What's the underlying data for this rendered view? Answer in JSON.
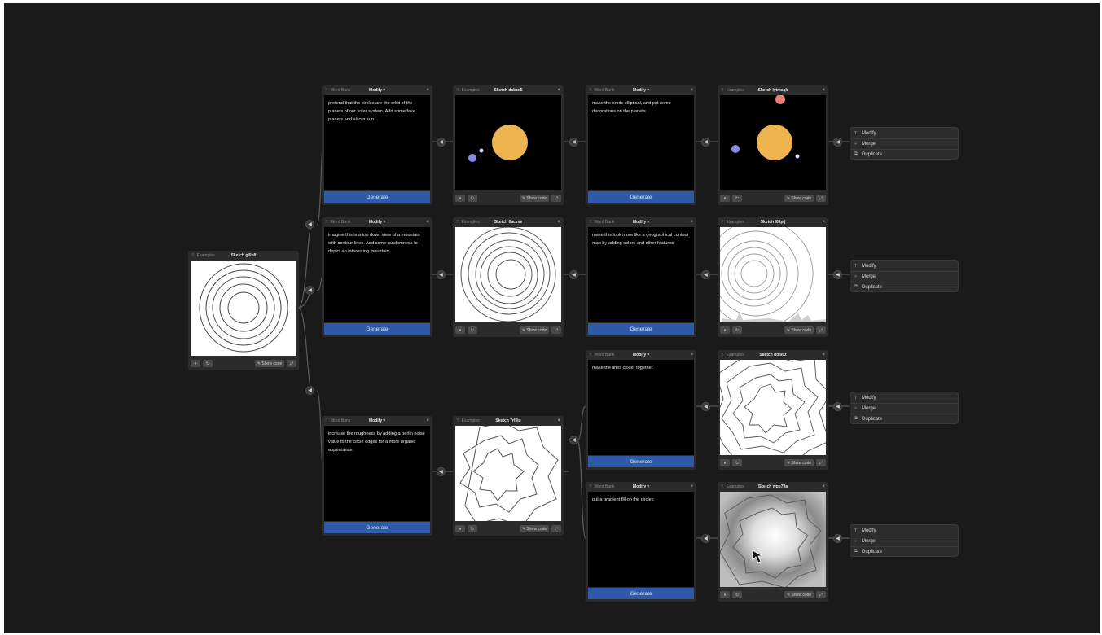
{
  "colors": {
    "canvas": "#1a1a1a",
    "card": "#2b2b2b",
    "generate": "#2e5aa8",
    "sun": "#eeb450",
    "planet": "#8c86e6",
    "red_planet": "#e87c78"
  },
  "root": {
    "source": "Examples",
    "title": "Sketch gl0n8",
    "show_code": "Show code"
  },
  "prompts": [
    {
      "source": "Word Bank",
      "mode": "Modify",
      "text": "pretend that the circles are the orbit of the planets of our solar system. Add some fake planets and also a sun.",
      "button": "Generate"
    },
    {
      "source": "Word Bank",
      "mode": "Modify",
      "text": "imagine this is a top down view of a mountain with contour lines. Add some randomness to depict an interesting mountain",
      "button": "Generate"
    },
    {
      "source": "Word Bank",
      "mode": "Modify",
      "text": "increase the roughness by adding a perlin noise value to the circle edges for a more organic appearance.",
      "button": "Generate"
    },
    {
      "source": "Word Bank",
      "mode": "Modify",
      "text": "make the orbits elliptical, and put some decorations on the planets",
      "button": "Generate"
    },
    {
      "source": "Word Bank",
      "mode": "Modify",
      "text": "make this look more like a geographical contour map by adding colors and other features",
      "button": "Generate"
    },
    {
      "source": "Word Bank",
      "mode": "Modify",
      "text": "make the lines closer together",
      "button": "Generate"
    },
    {
      "source": "Word Bank",
      "mode": "Modify",
      "text": "put a gradient fill on the circles",
      "button": "Generate"
    }
  ],
  "sketches": [
    {
      "source": "Examples",
      "title": "Sketch dabcx5",
      "show_code": "Show code"
    },
    {
      "source": "Examples",
      "title": "Sketch 0acvxe",
      "show_code": "Show code"
    },
    {
      "source": "Examples",
      "title": "Sketch 7rl5lu",
      "show_code": "Show code"
    },
    {
      "source": "Examples",
      "title": "Sketch lytmaqk",
      "show_code": "Show code"
    },
    {
      "source": "Examples",
      "title": "Sketch l03pij",
      "show_code": "Show code"
    },
    {
      "source": "Examples",
      "title": "Sketch bol95z",
      "show_code": "Show code"
    },
    {
      "source": "Examples",
      "title": "Sketch wqu79a",
      "show_code": "Show code"
    }
  ],
  "menu": {
    "items": [
      "Modify",
      "Merge",
      "Duplicate"
    ],
    "icons": [
      "text-icon",
      "merge-icon",
      "duplicate-icon"
    ]
  }
}
